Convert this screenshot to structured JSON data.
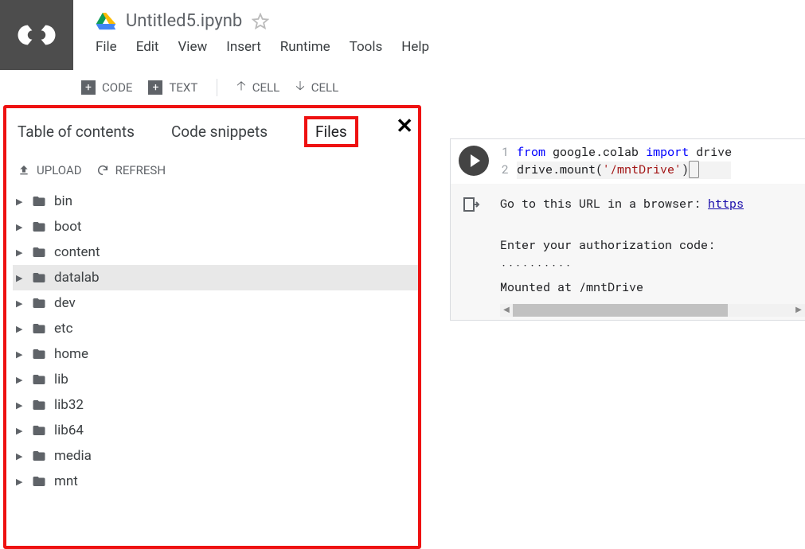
{
  "header": {
    "filename": "Untitled5.ipynb",
    "menus": [
      "File",
      "Edit",
      "View",
      "Insert",
      "Runtime",
      "Tools",
      "Help"
    ]
  },
  "toolbar": {
    "code": "CODE",
    "text": "TEXT",
    "cell_up": "CELL",
    "cell_down": "CELL"
  },
  "sidepanel": {
    "tabs": [
      "Table of contents",
      "Code snippets",
      "Files"
    ],
    "active_tab_index": 2,
    "actions": {
      "upload": "UPLOAD",
      "refresh": "REFRESH"
    },
    "tree": [
      {
        "name": "bin",
        "selected": false
      },
      {
        "name": "boot",
        "selected": false
      },
      {
        "name": "content",
        "selected": false
      },
      {
        "name": "datalab",
        "selected": true
      },
      {
        "name": "dev",
        "selected": false
      },
      {
        "name": "etc",
        "selected": false
      },
      {
        "name": "home",
        "selected": false
      },
      {
        "name": "lib",
        "selected": false
      },
      {
        "name": "lib32",
        "selected": false
      },
      {
        "name": "lib64",
        "selected": false
      },
      {
        "name": "media",
        "selected": false
      },
      {
        "name": "mnt",
        "selected": false
      }
    ]
  },
  "code": {
    "line1": {
      "kw1": "from",
      "mod": " google.colab ",
      "kw2": "import",
      "imp": " drive"
    },
    "line2": {
      "call": "drive.mount(",
      "arg": "'/mntDrive'",
      "close": ")"
    }
  },
  "output": {
    "line1_pre": "Go to this URL in a browser: ",
    "line1_link": "https",
    "line2": "",
    "line3": "Enter your authorization code:",
    "line4": "··········",
    "line5": "Mounted at /mntDrive"
  }
}
